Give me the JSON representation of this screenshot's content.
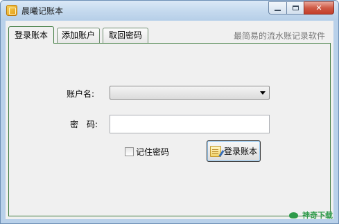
{
  "window": {
    "title": "晨曦记账本",
    "min_label": "minimize",
    "max_label": "maximize",
    "close_symbol": "✕"
  },
  "tabs": [
    {
      "label": "登录账本",
      "active": true
    },
    {
      "label": "添加账户",
      "active": false
    },
    {
      "label": "取回密码",
      "active": false
    }
  ],
  "slogan": "最简易的流水账记录软件",
  "form": {
    "account_label": "账户名:",
    "account_value": "",
    "password_label": "密　码:",
    "password_value": "",
    "remember_label": "记住密码",
    "remember_checked": false,
    "login_button": "登录账本"
  },
  "watermark": {
    "text": "神奇下载"
  },
  "icons": {
    "app": "ledger-app-icon",
    "login_button": "notepad-pen-icon",
    "watermark": "leaf-icon",
    "select": "chevron-down-icon"
  },
  "colors": {
    "tab_border": "#3d7a3d",
    "slogan": "#777777",
    "watermark": "#2e9a4a"
  }
}
